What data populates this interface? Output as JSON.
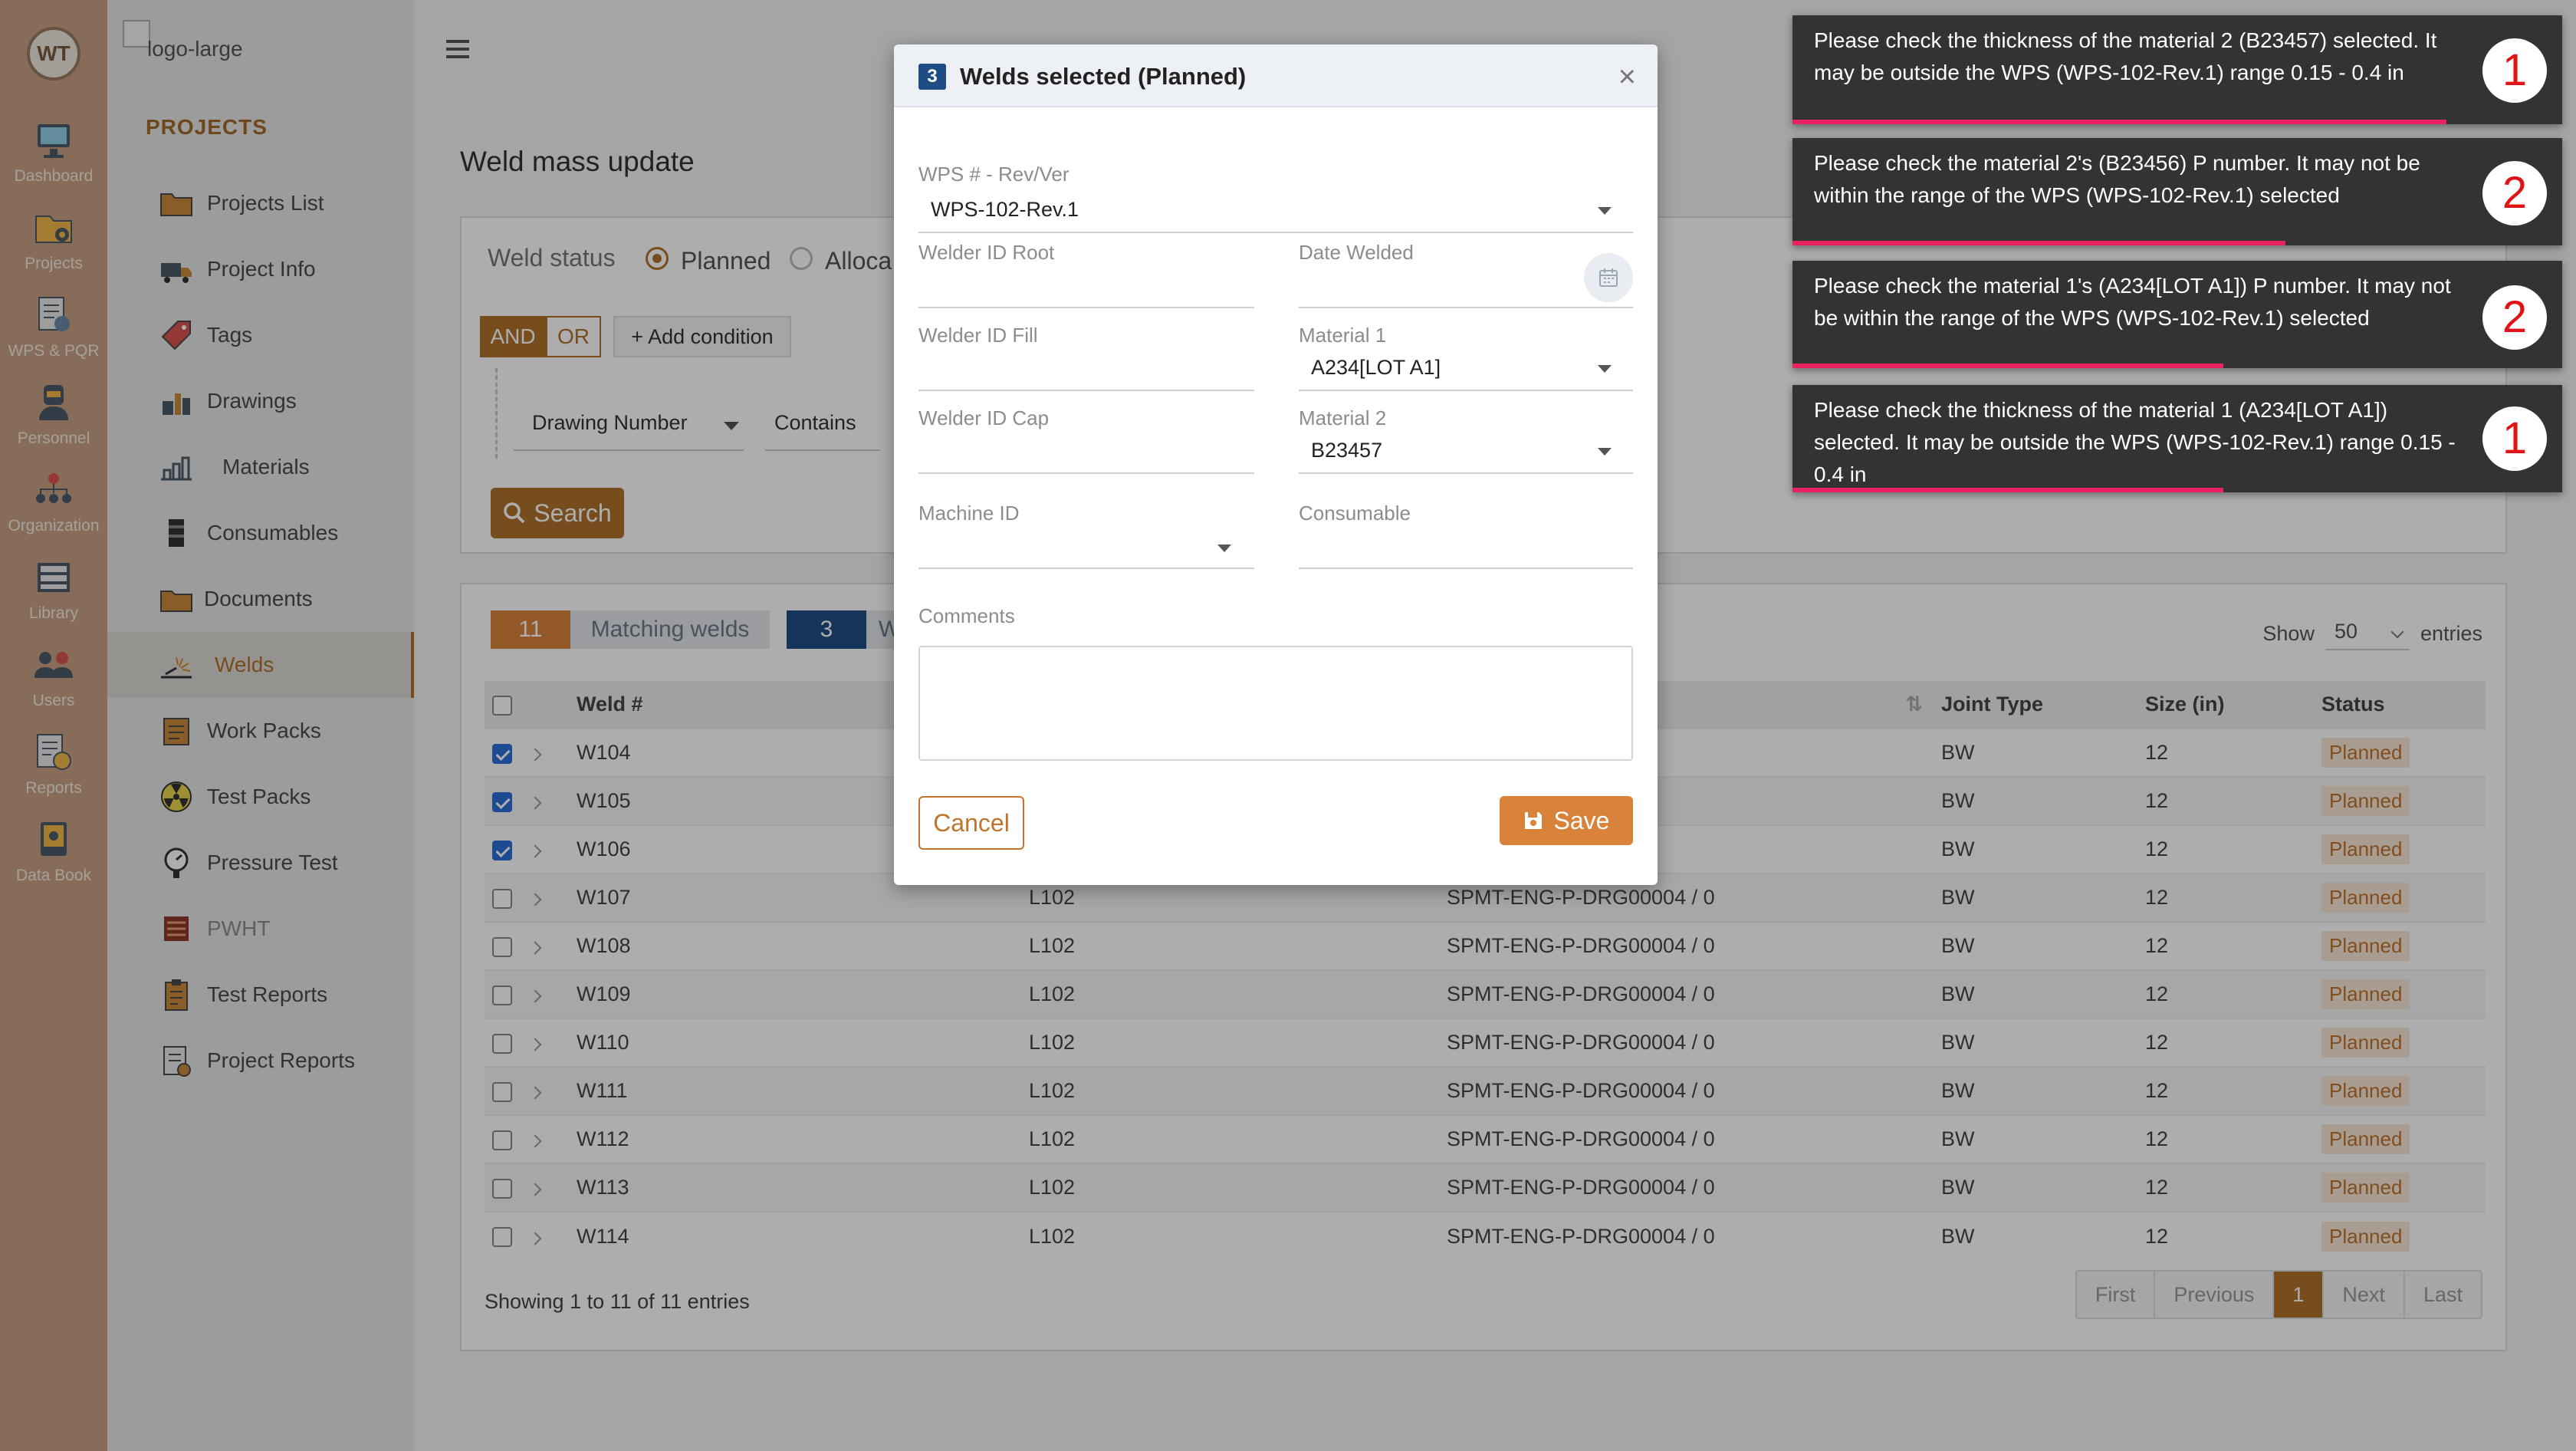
{
  "rail": {
    "items": [
      {
        "label": "Dashboard",
        "icon": "dashboard-icon"
      },
      {
        "label": "Projects",
        "icon": "projects-icon"
      },
      {
        "label": "WPS & PQR",
        "icon": "wps-pqr-icon"
      },
      {
        "label": "Personnel",
        "icon": "personnel-icon"
      },
      {
        "label": "Organization",
        "icon": "organization-icon"
      },
      {
        "label": "Library",
        "icon": "library-icon"
      },
      {
        "label": "Users",
        "icon": "users-icon"
      },
      {
        "label": "Reports",
        "icon": "reports-icon"
      },
      {
        "label": "Data Book",
        "icon": "data-book-icon"
      }
    ]
  },
  "nav": {
    "logo_alt": "logo-large",
    "section": "PROJECTS",
    "items": [
      {
        "label": "Projects List",
        "icon": "folder-icon"
      },
      {
        "label": "Project Info",
        "icon": "truck-icon"
      },
      {
        "label": "Tags",
        "icon": "tag-icon"
      },
      {
        "label": "Drawings",
        "icon": "drawings-icon"
      },
      {
        "label": "Materials",
        "icon": "materials-icon"
      },
      {
        "label": "Consumables",
        "icon": "consumables-icon"
      },
      {
        "label": "Documents",
        "icon": "documents-icon"
      },
      {
        "label": "Welds",
        "icon": "weld-icon"
      },
      {
        "label": "Work Packs",
        "icon": "work-packs-icon"
      },
      {
        "label": "Test Packs",
        "icon": "radiation-icon"
      },
      {
        "label": "Pressure Test",
        "icon": "pressure-gauge-icon"
      },
      {
        "label": "PWHT",
        "icon": "pwht-icon"
      },
      {
        "label": "Test Reports",
        "icon": "clipboard-icon"
      },
      {
        "label": "Project Reports",
        "icon": "project-reports-icon"
      }
    ]
  },
  "main": {
    "page_title": "Weld mass update",
    "filter": {
      "weld_status_label": "Weld status",
      "radio_planned": "Planned",
      "radio_allocated": "Alloca",
      "and_label": "AND",
      "or_label": "OR",
      "add_condition_label": "+ Add condition",
      "field_value": "Drawing Number",
      "operator_value": "Contains",
      "search_label": "Search"
    },
    "table": {
      "matching_count": "11",
      "matching_label": "Matching welds",
      "selected_count": "3",
      "selected_label": "W",
      "show_label": "Show",
      "entries_value": "50",
      "entries_label": "entries",
      "headers": {
        "weld": "Weld #",
        "joint": "Joint Type",
        "size": "Size (in)",
        "status": "Status"
      },
      "rows": [
        {
          "checked": true,
          "weld": "W104",
          "line": "",
          "drawing": "0004 / 0",
          "joint": "BW",
          "size": "12",
          "status": "Planned"
        },
        {
          "checked": true,
          "weld": "W105",
          "line": "",
          "drawing": "0004 / 0",
          "joint": "BW",
          "size": "12",
          "status": "Planned"
        },
        {
          "checked": true,
          "weld": "W106",
          "line": "",
          "drawing": "0004 / 0",
          "joint": "BW",
          "size": "12",
          "status": "Planned"
        },
        {
          "checked": false,
          "weld": "W107",
          "line": "L102",
          "drawing": "SPMT-ENG-P-DRG00004 / 0",
          "joint": "BW",
          "size": "12",
          "status": "Planned"
        },
        {
          "checked": false,
          "weld": "W108",
          "line": "L102",
          "drawing": "SPMT-ENG-P-DRG00004 / 0",
          "joint": "BW",
          "size": "12",
          "status": "Planned"
        },
        {
          "checked": false,
          "weld": "W109",
          "line": "L102",
          "drawing": "SPMT-ENG-P-DRG00004 / 0",
          "joint": "BW",
          "size": "12",
          "status": "Planned"
        },
        {
          "checked": false,
          "weld": "W110",
          "line": "L102",
          "drawing": "SPMT-ENG-P-DRG00004 / 0",
          "joint": "BW",
          "size": "12",
          "status": "Planned"
        },
        {
          "checked": false,
          "weld": "W111",
          "line": "L102",
          "drawing": "SPMT-ENG-P-DRG00004 / 0",
          "joint": "BW",
          "size": "12",
          "status": "Planned"
        },
        {
          "checked": false,
          "weld": "W112",
          "line": "L102",
          "drawing": "SPMT-ENG-P-DRG00004 / 0",
          "joint": "BW",
          "size": "12",
          "status": "Planned"
        },
        {
          "checked": false,
          "weld": "W113",
          "line": "L102",
          "drawing": "SPMT-ENG-P-DRG00004 / 0",
          "joint": "BW",
          "size": "12",
          "status": "Planned"
        },
        {
          "checked": false,
          "weld": "W114",
          "line": "L102",
          "drawing": "SPMT-ENG-P-DRG00004 / 0",
          "joint": "BW",
          "size": "12",
          "status": "Planned"
        }
      ],
      "showing_text": "Showing 1 to 11 of 11 entries",
      "pager": {
        "first": "First",
        "previous": "Previous",
        "current": "1",
        "next": "Next",
        "last": "Last"
      }
    }
  },
  "modal": {
    "count": "3",
    "title": "Welds selected (Planned)",
    "close": "×",
    "wps_label": "WPS # - Rev/Ver",
    "wps_value": "WPS-102-Rev.1",
    "welder_root_label": "Welder ID Root",
    "date_welded_label": "Date Welded",
    "welder_fill_label": "Welder ID Fill",
    "material1_label": "Material 1",
    "material1_value": "A234[LOT A1]",
    "welder_cap_label": "Welder ID Cap",
    "material2_label": "Material 2",
    "material2_value": "B23457",
    "machine_label": "Machine ID",
    "consumable_label": "Consumable",
    "comments_label": "Comments",
    "cancel_label": "Cancel",
    "save_label": "Save"
  },
  "toasts": [
    {
      "text": "Please check the thickness of the material 2 (B23457) selected. It may be outside the WPS (WPS-102-Rev.1) range 0.15 - 0.4 in",
      "count": "1",
      "progress": 0.85
    },
    {
      "text": "Please check the material 2's (B23456) P number. It may not be within the range of the WPS (WPS-102-Rev.1) selected",
      "count": "2",
      "progress": 0.64
    },
    {
      "text": "Please check the material 1's (A234[LOT A1]) P number. It may not be within the range of the WPS (WPS-102-Rev.1) selected",
      "count": "2",
      "progress": 0.56
    },
    {
      "text": "Please check the thickness of the material 1 (A234[LOT A1]) selected. It may be outside the WPS (WPS-102-Rev.1) range 0.15 - 0.4 in",
      "count": "1",
      "progress": 0.56
    }
  ],
  "colors": {
    "accent": "#b0722c",
    "toast_bg": "#333333",
    "toast_bar": "#e8235f",
    "badge_navy": "#1e4d84"
  }
}
